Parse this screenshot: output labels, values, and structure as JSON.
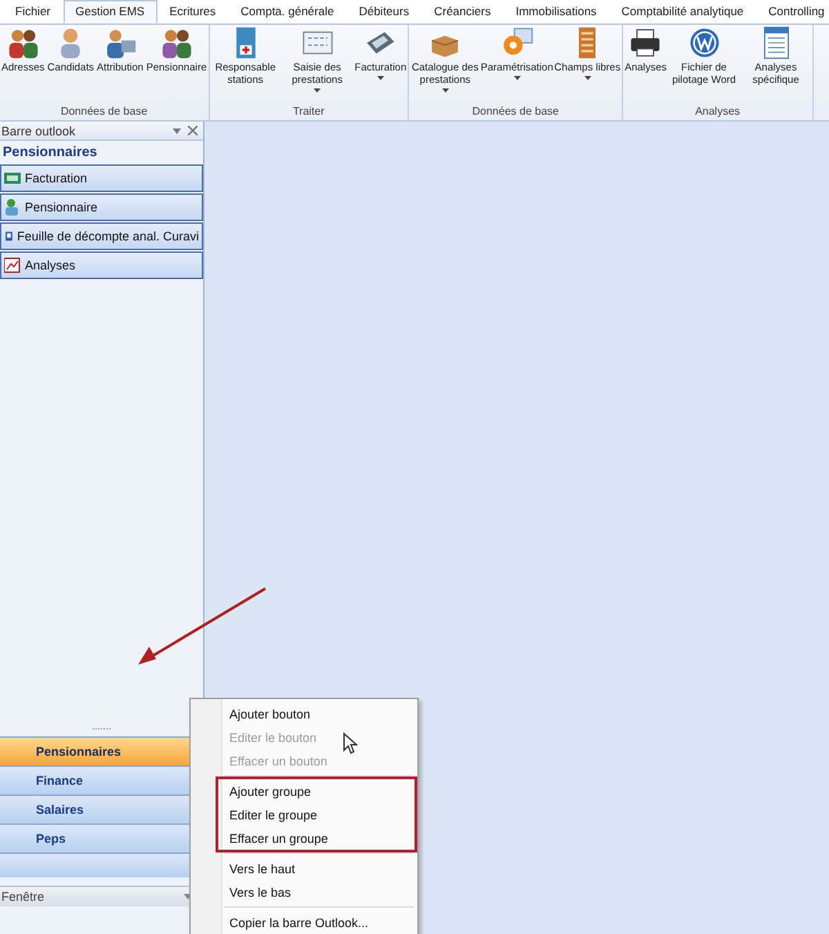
{
  "tabs": [
    {
      "label": "Fichier",
      "selected": false
    },
    {
      "label": "Gestion EMS",
      "selected": true
    },
    {
      "label": "Ecritures",
      "selected": false
    },
    {
      "label": "Compta. générale",
      "selected": false
    },
    {
      "label": "Débiteurs",
      "selected": false
    },
    {
      "label": "Créanciers",
      "selected": false
    },
    {
      "label": "Immobilisations",
      "selected": false
    },
    {
      "label": "Comptabilité analytique",
      "selected": false
    },
    {
      "label": "Controlling",
      "selected": false
    }
  ],
  "ribbon_groups": [
    {
      "label": "Données de base",
      "buttons": [
        {
          "label": "Adresses",
          "dropdown": false
        },
        {
          "label": "Candidats",
          "dropdown": false
        },
        {
          "label": "Attribution",
          "dropdown": false
        },
        {
          "label": "Pensionnaire",
          "dropdown": false
        }
      ]
    },
    {
      "label": "Traiter",
      "buttons": [
        {
          "label": "Responsable stations",
          "dropdown": false
        },
        {
          "label": "Saisie des prestations",
          "dropdown": true
        },
        {
          "label": "Facturation",
          "dropdown": true
        }
      ]
    },
    {
      "label": "Données de base",
      "buttons": [
        {
          "label": "Catalogue des prestations",
          "dropdown": true
        },
        {
          "label": "Paramétrisation",
          "dropdown": true
        },
        {
          "label": "Champs libres",
          "dropdown": true
        }
      ]
    },
    {
      "label": "Analyses",
      "buttons": [
        {
          "label": "Analyses",
          "dropdown": false
        },
        {
          "label": "Fichier de pilotage Word",
          "dropdown": false
        },
        {
          "label": "Analyses spécifique",
          "dropdown": false
        }
      ]
    }
  ],
  "outlook_bar": {
    "title": "Barre outlook",
    "group_title": "Pensionnaires",
    "items": [
      {
        "label": "Facturation"
      },
      {
        "label": "Pensionnaire"
      },
      {
        "label": "Feuille de décompte anal. Curavi"
      },
      {
        "label": "Analyses"
      }
    ],
    "groups": [
      {
        "label": "Pensionnaires",
        "selected": true
      },
      {
        "label": "Finance",
        "selected": false
      },
      {
        "label": "Salaires",
        "selected": false
      },
      {
        "label": "Peps",
        "selected": false
      }
    ],
    "footer": "Fenêtre"
  },
  "context_menu": [
    {
      "highlighted": false,
      "items": [
        {
          "label": "Ajouter bouton",
          "disabled": false
        },
        {
          "label": "Editer le bouton",
          "disabled": true
        },
        {
          "label": "Effacer un bouton",
          "disabled": true
        }
      ]
    },
    {
      "highlighted": true,
      "items": [
        {
          "label": "Ajouter groupe",
          "disabled": false
        },
        {
          "label": "Editer le groupe",
          "disabled": false
        },
        {
          "label": "Effacer un groupe",
          "disabled": false
        }
      ]
    },
    {
      "highlighted": false,
      "items": [
        {
          "label": "Vers le haut",
          "disabled": false
        },
        {
          "label": "Vers le bas",
          "disabled": false
        }
      ]
    },
    {
      "highlighted": false,
      "items": [
        {
          "label": "Copier la barre Outlook...",
          "disabled": false
        }
      ]
    }
  ]
}
